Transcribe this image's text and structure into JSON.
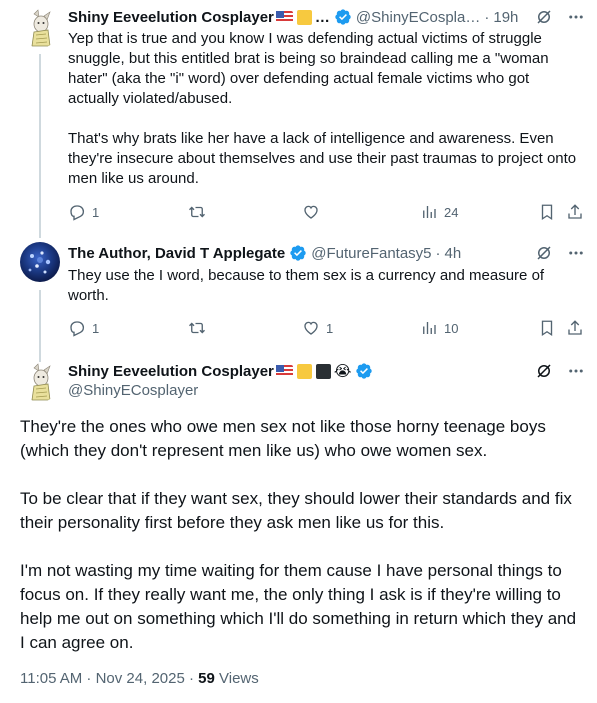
{
  "tweet1": {
    "name": "Shiny Eeveelution Cosplayer",
    "name_suffix": "…",
    "handle": "@ShinyECospla…",
    "dot": "·",
    "time": "19h",
    "paragraphs": [
      "Yep that is true and you know I was defending actual victims of struggle snuggle, but this entitled brat is being so braindead calling me a \"woman hater\" (aka the \"i\" word) over defending actual female victims who got actually violated/abused.",
      "That's why brats like her have a lack of intelligence and awareness. Even they're insecure about themselves and use their past traumas to project onto men like us around."
    ],
    "replies": "1",
    "views": "24"
  },
  "tweet2": {
    "name": "The Author, David T Applegate",
    "handle": "@FutureFantasy5",
    "dot": "·",
    "time": "4h",
    "text": "They use the I word, because to them sex is a currency and measure of worth.",
    "replies": "1",
    "likes": "1",
    "views": "10"
  },
  "main": {
    "name": "Shiny Eeveelution Cosplayer",
    "handle": "@ShinyECosplayer",
    "emoji": "😭",
    "paragraphs": [
      "They're the ones who owe men sex not like those horny teenage boys (which they don't represent men like us) who owe women sex.",
      "To be clear that if they want sex, they should lower their standards and fix their personality first before they ask men like us for this.",
      "I'm not wasting my time waiting for them cause I have personal things to focus on. If they really want me, the only thing I ask is if they're willing to help me out on something which I'll do something in return which they and I can agree on."
    ],
    "timestamp": "11:05 AM · Nov 24, 2025 · ",
    "views_count": "59",
    "views_label": " Views"
  },
  "colors": {
    "accent": "#1d9bf0",
    "muted": "#536471",
    "text": "#0f1419",
    "line": "#cfd9de"
  },
  "icons": [
    "grok-icon",
    "more-icon",
    "reply-icon",
    "retweet-icon",
    "like-icon",
    "views-icon",
    "bookmark-icon",
    "share-icon",
    "verified-icon"
  ]
}
